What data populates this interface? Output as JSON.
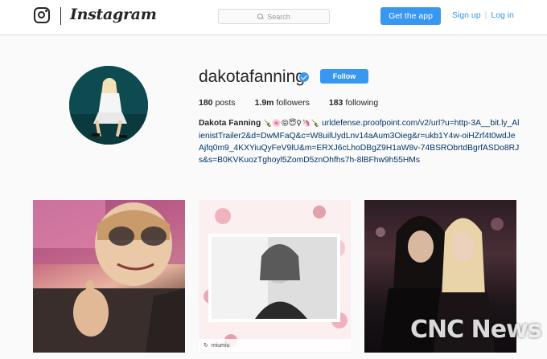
{
  "header": {
    "wordmark": "Instagram",
    "search_placeholder": "Search",
    "get_app_label": "Get the app",
    "sign_up_label": "Sign up",
    "separator": "|",
    "log_in_label": "Log in"
  },
  "profile": {
    "username": "dakotafanning",
    "verified": true,
    "follow_label": "Follow",
    "stats": {
      "posts_count": "180",
      "posts_label": "posts",
      "followers_count": "1.9m",
      "followers_label": "followers",
      "following_count": "183",
      "following_label": "following"
    },
    "bio": {
      "name": "Dakota Fanning",
      "emoji": "🍾🌸😝😇♀🦄🍾",
      "link": "urldefense.proofpoint.com/v2/url?u=http-3A__bit.ly_AlienistTrailer2&d=DwMFaQ&c=W8uilUydLnv14aAum3Oieg&r=ukb1Y4w-oiHZrf4t0wdJeAjfq0m9_4KXYiuQyFeV9lU&m=ERXJ6cLhoDBgZ9H1aW8v-74BSRObrtdBgrfASDo8RJs&s=B0KVKuozTghoyl5ZomD5znOhfhs7h-8lBFhw9h55HMs"
    }
  },
  "posts": [
    {
      "kind": "selfie-thumbs-up"
    },
    {
      "kind": "black-white-portrait",
      "repost_user": "miumiu"
    },
    {
      "kind": "party-photo"
    }
  ],
  "watermark": "CNC News",
  "colors": {
    "accent": "#3897f0",
    "link": "#003569",
    "background": "#fafafa"
  }
}
